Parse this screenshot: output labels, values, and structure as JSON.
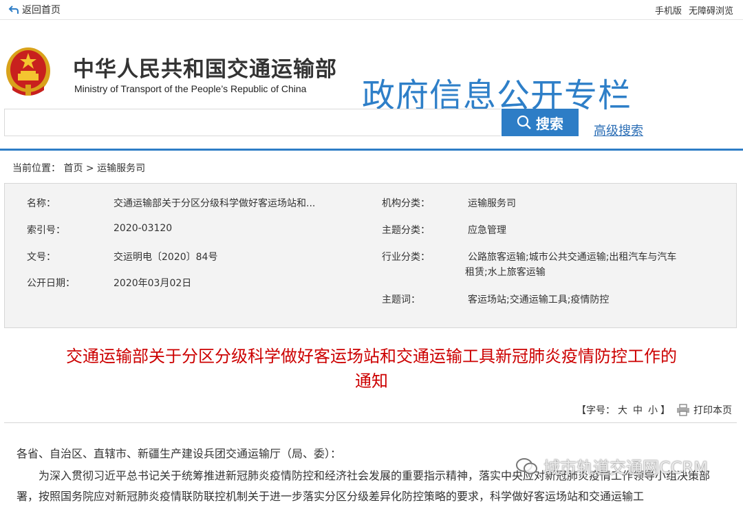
{
  "topbar": {
    "back_label": "返回首页",
    "mobile_label": "手机版",
    "accessible_label": "无障碍浏览"
  },
  "header": {
    "cn_name": "中华人民共和国交通运输部",
    "en_name": "Ministry of Transport of the People’s Republic of China",
    "banner": "政府信息公开专栏"
  },
  "search": {
    "placeholder": "",
    "button_label": "搜索",
    "advanced_label": "高级搜索"
  },
  "breadcrumb": {
    "prefix": "当前位置：",
    "home": "首页",
    "sep": " >",
    "current": "运输服务司"
  },
  "info": {
    "name_label": "名称：",
    "name_value": "交通运输部关于分区分级科学做好客运场站和...",
    "index_label": "索引号：",
    "index_value": "2020-03120",
    "doc_label": "文号：",
    "doc_value": "交运明电〔2020〕84号",
    "date_label": "公开日期：",
    "date_value": "2020年03月02日",
    "org_label": "机构分类：",
    "org_value": "运输服务司",
    "topic_label": "主题分类：",
    "topic_value": "应急管理",
    "industry_label": "行业分类：",
    "industry_value_1": "公路旅客运输;城市公共交通运输;出租汽车与汽车",
    "industry_value_2": "租赁;水上旅客运输",
    "keyword_label": "主题词：",
    "keyword_value": "客运场站;交通运输工具;疫情防控"
  },
  "article": {
    "title_line1": "交通运输部关于分区分级科学做好客运场站和交通运输工具新冠肺炎疫情防控工作的",
    "title_line2": "通知",
    "font_prefix": "【字号：",
    "font_large": "大",
    "font_medium": "中",
    "font_small": "小",
    "font_suffix": "】",
    "print_label": "打印本页",
    "salutation": "各省、自治区、直辖市、新疆生产建设兵团交通运输厅（局、委）：",
    "para_line1": "为深入贯彻习近平总书记关于统筹推进新冠肺炎疫情防控和经济社会发展的重要指示精神，落实中央应对新冠肺炎疫情工作领导小组",
    "para_line2": "决策部署，按照国务院应对新冠肺炎疫情联防联控机制关于进一步落实分区分级差异化防控策略的要求，科学做好客运场站和交通运输工"
  },
  "watermark": {
    "text": "城市轨道交通网CCRM"
  },
  "colors": {
    "accent": "#2d7dc6",
    "title_red": "#cc0000",
    "banner_blue": "#2e7fc8"
  }
}
